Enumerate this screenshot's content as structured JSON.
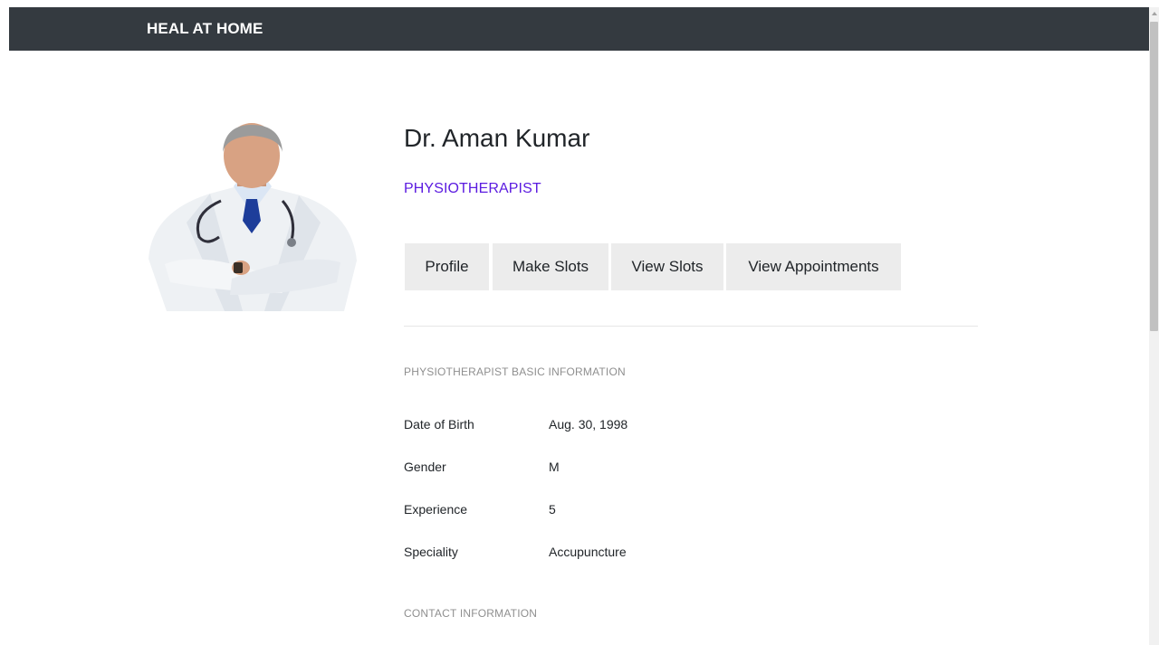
{
  "navbar": {
    "brand": "HEAL AT HOME"
  },
  "profile": {
    "name": "Dr. Aman Kumar",
    "role": "PHYSIOTHERAPIST",
    "role_color": "#5b1be0"
  },
  "tabs": [
    {
      "label": "Profile"
    },
    {
      "label": "Make Slots"
    },
    {
      "label": "View Slots"
    },
    {
      "label": "View Appointments"
    }
  ],
  "basic_info": {
    "title": "PHYSIOTHERAPIST BASIC INFORMATION",
    "rows": [
      {
        "label": "Date of Birth",
        "value": "Aug. 30, 1998"
      },
      {
        "label": "Gender",
        "value": "M"
      },
      {
        "label": "Experience",
        "value": "5"
      },
      {
        "label": "Speciality",
        "value": "Accupuncture"
      }
    ]
  },
  "contact_info": {
    "title": "CONTACT INFORMATION"
  },
  "colors": {
    "navbar_bg": "#343a40",
    "tab_bg": "#ececec"
  }
}
